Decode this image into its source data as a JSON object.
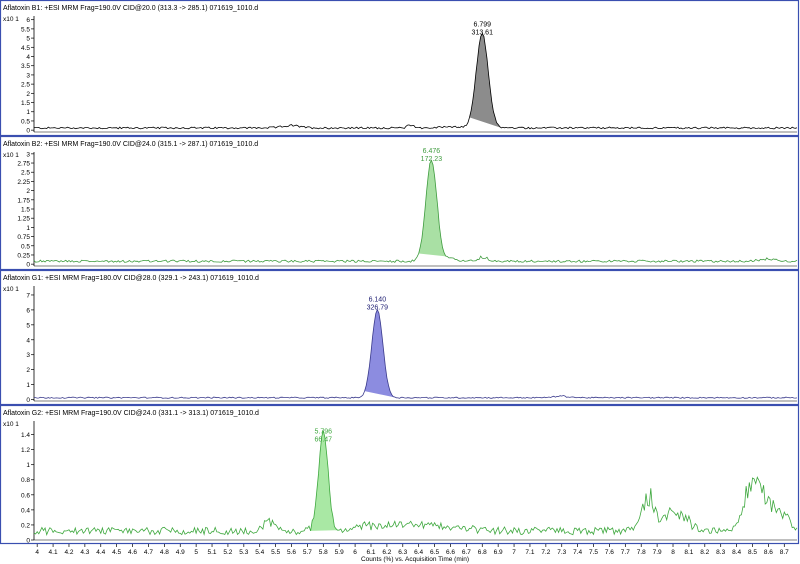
{
  "x_axis": {
    "label": "Counts (%) vs. Acquisition Time (min)",
    "ticks": [
      "4",
      "4.1",
      "4.2",
      "4.3",
      "4.4",
      "4.5",
      "4.6",
      "4.7",
      "4.8",
      "4.9",
      "5",
      "5.1",
      "5.2",
      "5.3",
      "5.4",
      "5.5",
      "5.6",
      "5.7",
      "5.8",
      "5.9",
      "6",
      "6.1",
      "6.2",
      "6.3",
      "6.4",
      "6.5",
      "6.6",
      "6.7",
      "6.8",
      "6.9",
      "7",
      "7.1",
      "7.2",
      "7.3",
      "7.4",
      "7.5",
      "7.6",
      "7.7",
      "7.8",
      "7.9",
      "8",
      "8.1",
      "8.2",
      "8.3",
      "8.4",
      "8.5",
      "8.6",
      "8.7"
    ]
  },
  "colors": {
    "panel_border": "#3a4fb0",
    "trace_b1": "#000000",
    "fill_b1": "#8c8c8c",
    "label_b1": "#000000",
    "trace_b2": "#3e9b3e",
    "fill_b2": "#a9e0a4",
    "label_b2": "#3e9b3e",
    "trace_g1": "#3a3a8c",
    "fill_g1": "#8c8ce0",
    "label_g1": "#1a1a70",
    "trace_g2": "#3ea83e",
    "fill_g2": "#a9e8a4",
    "label_g2": "#3ea83e"
  },
  "chart_data": [
    {
      "type": "line",
      "title": "Aflatoxin B1: +ESI MRM Frag=190.0V CID@20.0 (313.3 -> 285.1) 071619_1010.d",
      "scale_label": "x10 1",
      "xlim": [
        3.98,
        8.78
      ],
      "ylim": [
        -0.1,
        6.2
      ],
      "y_ticks": [
        "0",
        "0.5",
        "1",
        "1.5",
        "2",
        "2.5",
        "3",
        "3.5",
        "4",
        "4.5",
        "5",
        "5.5",
        "6"
      ],
      "peak": {
        "rt": 6.8,
        "height": 5.1,
        "sigma": 0.038,
        "rt_label": "6.799",
        "area_label": "313.61",
        "fill_from": 6.71,
        "fill_to": 6.92
      },
      "noise": {
        "baseline": 0.12,
        "amplitude": 0.05,
        "bumps": [
          [
            5.6,
            0.12,
            0.06
          ],
          [
            6.35,
            0.18,
            0.02
          ],
          [
            6.6,
            0.08,
            0.05
          ]
        ]
      },
      "grid": false,
      "legend": "none"
    },
    {
      "type": "line",
      "title": "Aflatoxin B2: +ESI MRM Frag=190.0V CID@24.0 (315.1 -> 287.1) 071619_1010.d",
      "scale_label": "x10 1",
      "xlim": [
        3.98,
        8.78
      ],
      "ylim": [
        -0.05,
        3.05
      ],
      "y_ticks": [
        "0",
        "0.25",
        "0.5",
        "0.75",
        "1",
        "1.25",
        "1.5",
        "1.75",
        "2",
        "2.25",
        "2.5",
        "2.75",
        "3"
      ],
      "peak": {
        "rt": 6.48,
        "height": 2.75,
        "sigma": 0.035,
        "rt_label": "6.476",
        "area_label": "172.23",
        "fill_from": 6.39,
        "fill_to": 6.58
      },
      "noise": {
        "baseline": 0.08,
        "amplitude": 0.03,
        "bumps": [
          [
            6.6,
            0.08,
            0.03
          ],
          [
            6.8,
            0.12,
            0.03
          ],
          [
            8.6,
            0.06,
            0.05
          ]
        ]
      },
      "grid": false,
      "legend": "none"
    },
    {
      "type": "line",
      "title": "Aflatoxin G1: +ESI MRM Frag=180.0V CID@28.0 (329.1 -> 243.1) 071619_1010.d",
      "scale_label": "x10 1",
      "xlim": [
        3.98,
        8.78
      ],
      "ylim": [
        -0.1,
        7.6
      ],
      "y_ticks": [
        "0",
        "1",
        "2",
        "3",
        "4",
        "5",
        "6",
        "7"
      ],
      "peak": {
        "rt": 6.14,
        "height": 5.9,
        "sigma": 0.035,
        "rt_label": "6.140",
        "area_label": "326.79",
        "fill_from": 6.05,
        "fill_to": 6.26
      },
      "noise": {
        "baseline": 0.12,
        "amplitude": 0.04,
        "bumps": [
          [
            7.3,
            0.1,
            0.05
          ]
        ]
      },
      "grid": false,
      "legend": "none"
    },
    {
      "type": "line",
      "title": "Aflatoxin G2: +ESI MRM Frag=190.0V CID@24.0 (331.1 -> 313.1) 071619_1010.d",
      "scale_label": "x10 1",
      "xlim": [
        3.98,
        8.78
      ],
      "ylim": [
        0,
        1.58
      ],
      "y_ticks": [
        "0",
        "0.2",
        "0.4",
        "0.6",
        "0.8",
        "1",
        "1.2",
        "1.4"
      ],
      "peak": {
        "rt": 5.8,
        "height": 1.28,
        "sigma": 0.03,
        "rt_label": "5.796",
        "area_label": "66.47",
        "fill_from": 5.72,
        "fill_to": 5.9
      },
      "noise": {
        "baseline": 0.12,
        "amplitude": 0.05,
        "bumps": [
          [
            5.45,
            0.12,
            0.04
          ],
          [
            6.3,
            0.1,
            0.25
          ],
          [
            7.85,
            0.45,
            0.04
          ],
          [
            7.97,
            0.2,
            0.03
          ],
          [
            8.05,
            0.22,
            0.05
          ],
          [
            8.5,
            0.65,
            0.05
          ],
          [
            8.6,
            0.3,
            0.05
          ],
          [
            8.7,
            0.18,
            0.04
          ]
        ]
      },
      "grid": false,
      "legend": "none"
    }
  ]
}
